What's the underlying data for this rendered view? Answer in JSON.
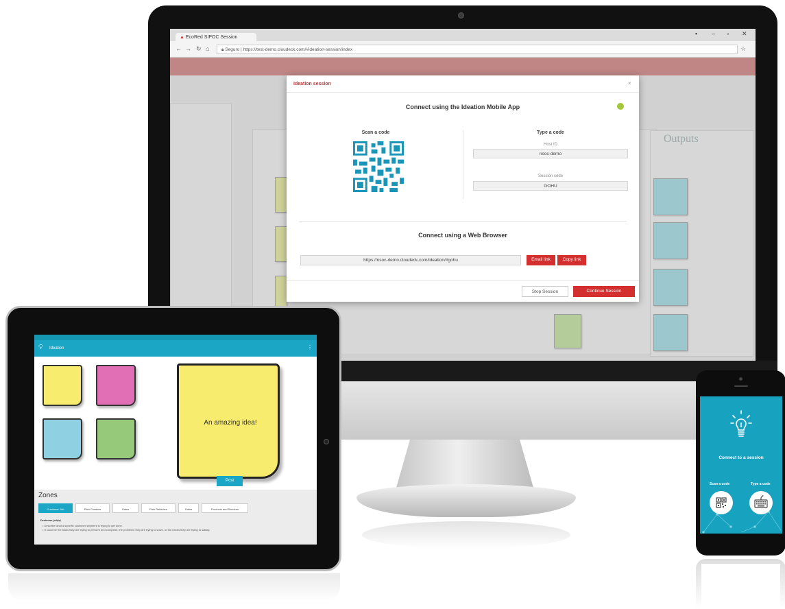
{
  "browser": {
    "tab_title": "EcoRed SIPOC Session",
    "url_secure": "Seguro",
    "url_path": "https://test-demo.cloudeck.com/#ideation-session/index"
  },
  "dialog": {
    "title": "Ideation session",
    "close": "×",
    "mobile_heading": "Connect using the Ideation Mobile App",
    "scan_label": "Scan a code",
    "type_label": "Type a code",
    "host_label": "Host ID",
    "host_value": "nsoc-demo",
    "session_label": "Session code",
    "session_value": "GOHU",
    "web_heading": "Connect using a Web Browser",
    "web_link": "https://nsoc-demo.cloudeck.com/ideation/#gohu",
    "email_btn": "Email link",
    "copy_btn": "Copy link",
    "stop_btn": "Stop Session",
    "continue_btn": "Continue Session"
  },
  "background": {
    "outputs_label": "Outputs"
  },
  "tablet": {
    "app_name": "Ideation",
    "note_text": "An amazing idea!",
    "post_btn": "Post",
    "zones_title": "Zones",
    "zone_tabs": [
      "Customer Job",
      "Pain Creators",
      "Gains",
      "Pain Relievers",
      "Gains",
      "Products and Services"
    ],
    "zone_heading": "Customer job(s)",
    "zone_lines": [
      "Describe what a specific customer segment is trying to get done.",
      "It could be the tasks they are trying to perform and complete, the problems they are trying to solve, or the needs they are trying to satisfy."
    ],
    "note_colors": [
      "#f7ec6e",
      "#e06fb6",
      "#8fd0e2",
      "#97c97a"
    ]
  },
  "phone": {
    "title": "Connect to a session",
    "scan_label": "Scan a code",
    "type_label": "Type a code"
  },
  "colors": {
    "accent_red": "#d32f2f",
    "accent_teal": "#1aa6c4"
  }
}
